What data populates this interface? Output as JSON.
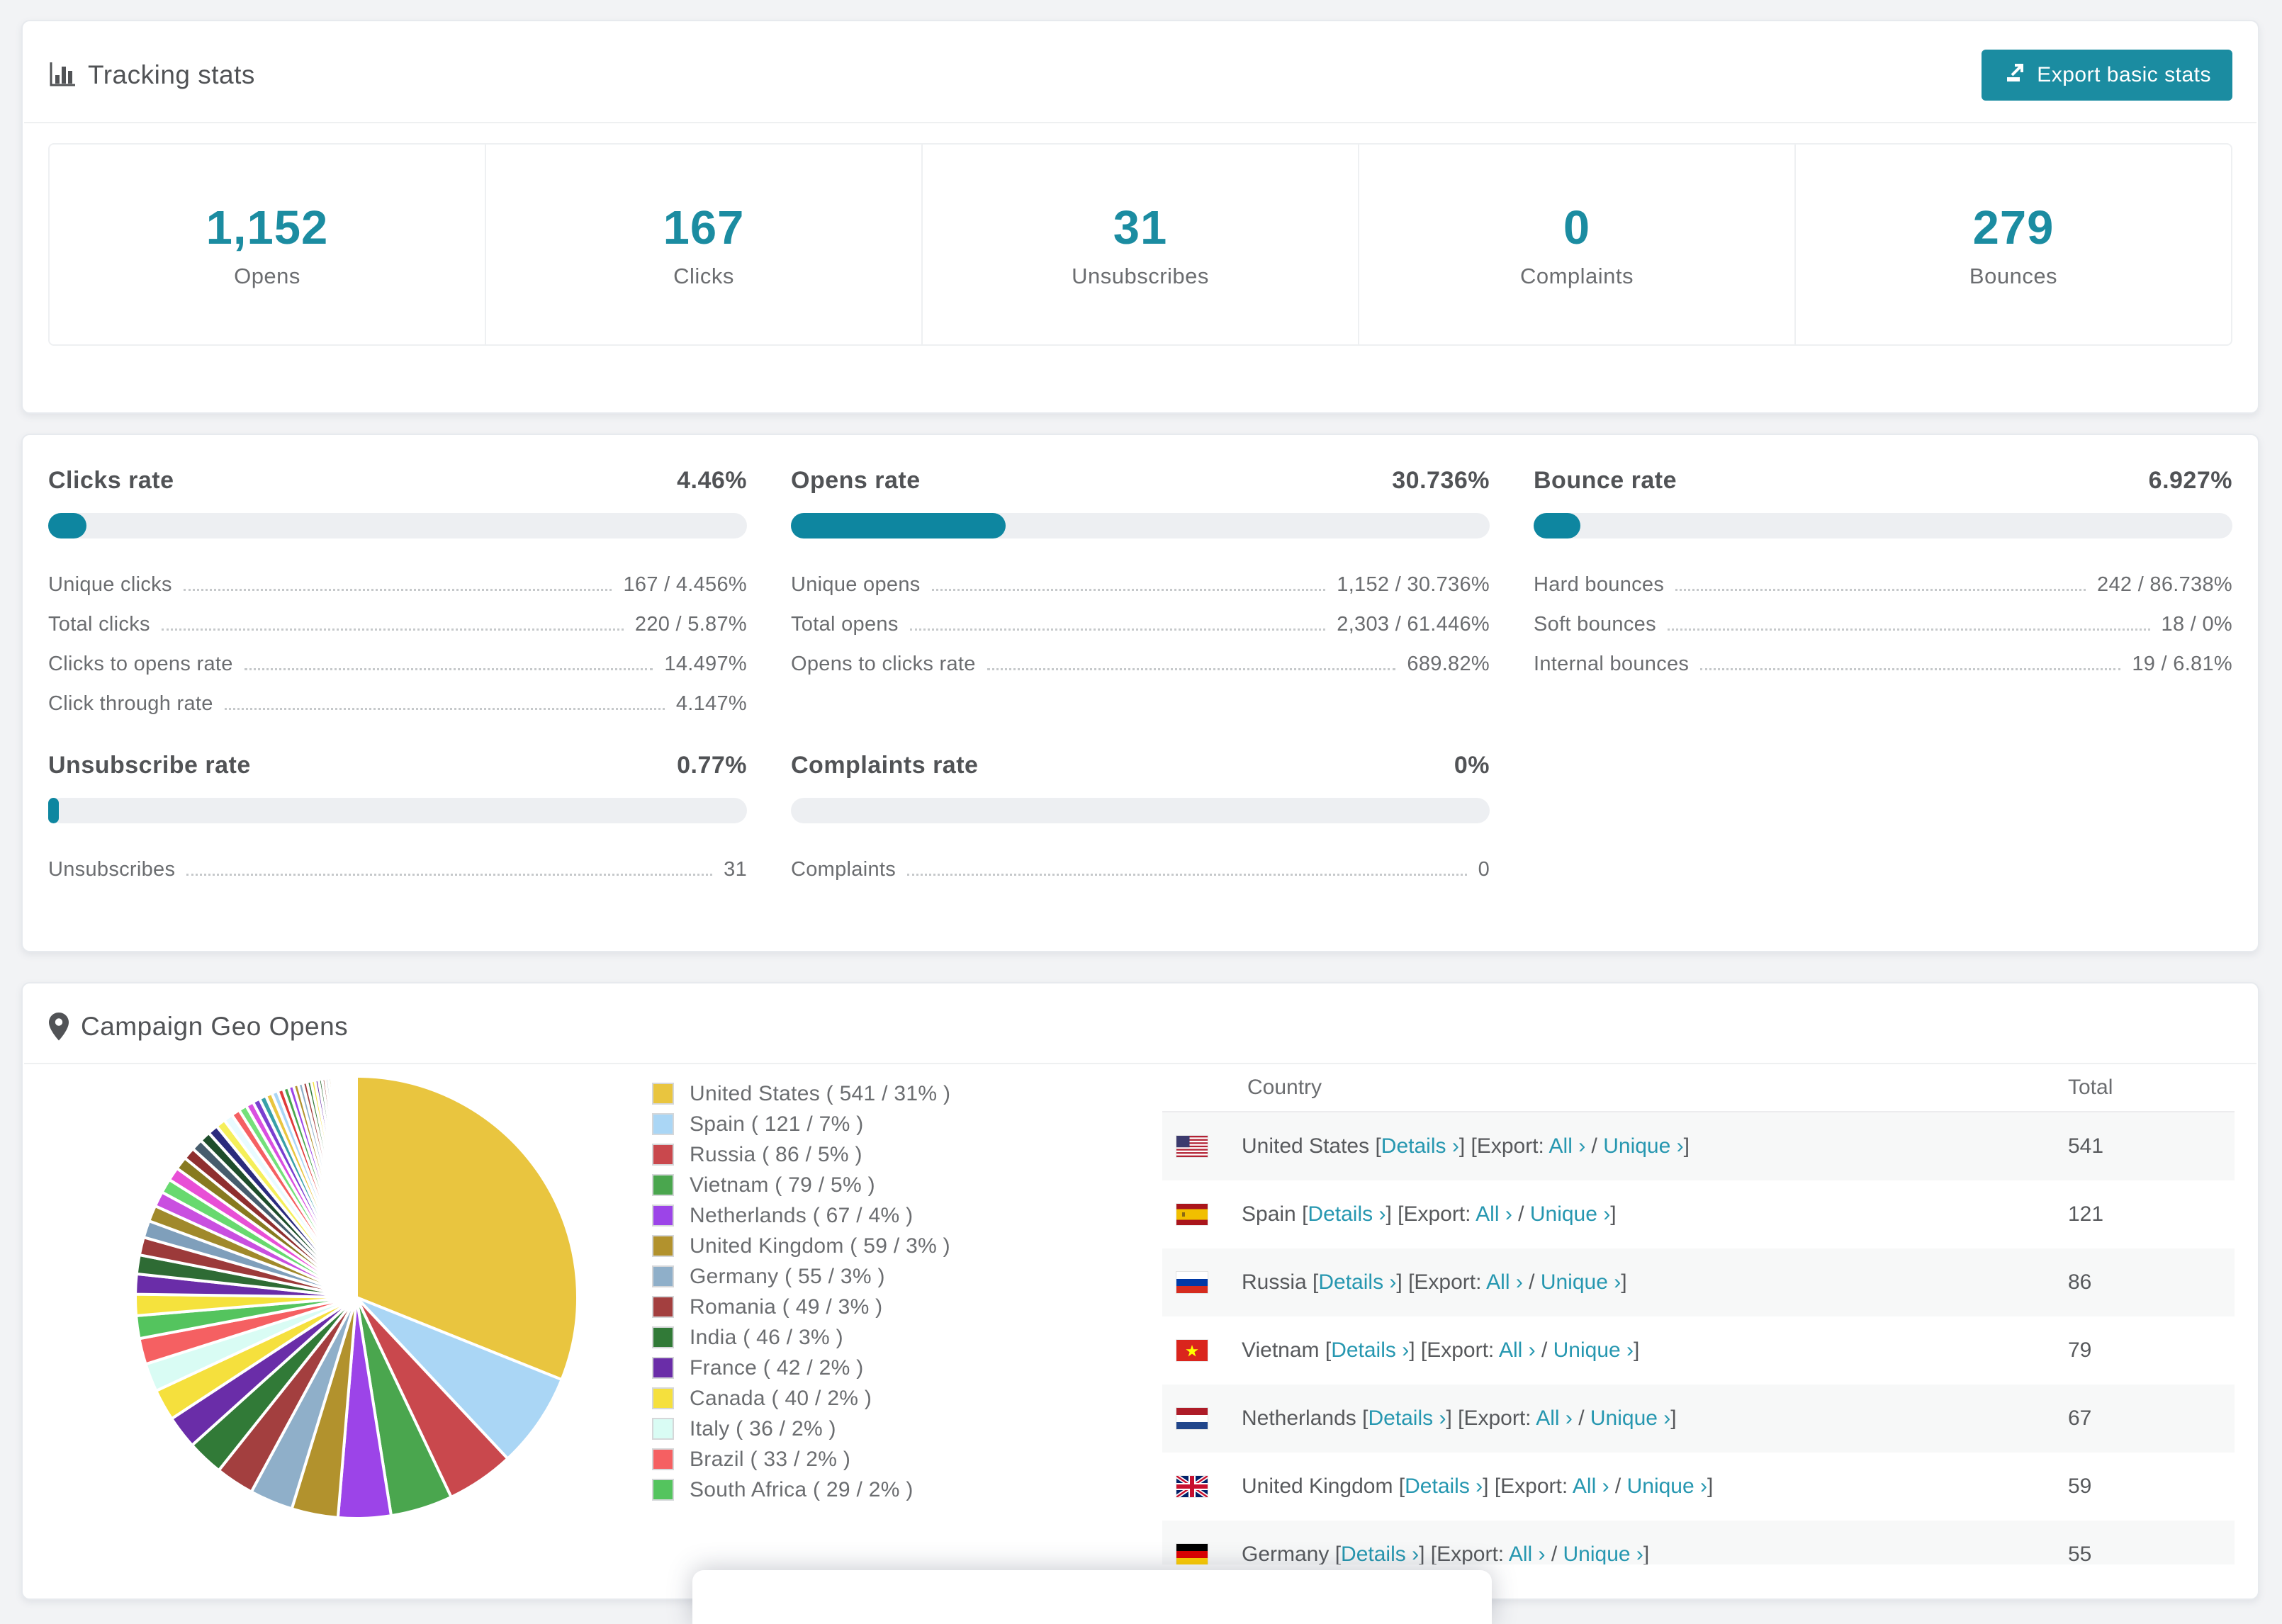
{
  "page": {
    "bg": "#f2f3f5",
    "accent": "#1b8ca1",
    "bar_fill": "#0e86a0",
    "link_color": "#2697b0"
  },
  "tracking": {
    "title": "Tracking stats",
    "export_button": "Export basic stats",
    "summary": [
      {
        "value": "1,152",
        "label": "Opens"
      },
      {
        "value": "167",
        "label": "Clicks"
      },
      {
        "value": "31",
        "label": "Unsubscribes"
      },
      {
        "value": "0",
        "label": "Complaints"
      },
      {
        "value": "279",
        "label": "Bounces"
      }
    ]
  },
  "rates": [
    {
      "title": "Clicks rate",
      "value": "4.46%",
      "fill_pct": 5.5,
      "lines": [
        {
          "label": "Unique clicks",
          "value": "167 / 4.456%"
        },
        {
          "label": "Total clicks",
          "value": "220 / 5.87%"
        },
        {
          "label": "Clicks to opens rate",
          "value": "14.497%"
        },
        {
          "label": "Click through rate",
          "value": "4.147%"
        }
      ]
    },
    {
      "title": "Opens rate",
      "value": "30.736%",
      "fill_pct": 30.7,
      "lines": [
        {
          "label": "Unique opens",
          "value": "1,152 / 30.736%"
        },
        {
          "label": "Total opens",
          "value": "2,303 / 61.446%"
        },
        {
          "label": "Opens to clicks rate",
          "value": "689.82%"
        }
      ]
    },
    {
      "title": "Bounce rate",
      "value": "6.927%",
      "fill_pct": 6.7,
      "lines": [
        {
          "label": "Hard bounces",
          "value": "242 / 86.738%"
        },
        {
          "label": "Soft bounces",
          "value": "18 / 0%"
        },
        {
          "label": "Internal bounces",
          "value": "19 / 6.81%"
        }
      ]
    },
    {
      "title": "Unsubscribe rate",
      "value": "0.77%",
      "fill_pct": 1.5,
      "lines": [
        {
          "label": "Unsubscribes",
          "value": "31"
        }
      ]
    },
    {
      "title": "Complaints rate",
      "value": "0%",
      "fill_pct": 0,
      "lines": [
        {
          "label": "Complaints",
          "value": "0"
        }
      ]
    }
  ],
  "geo": {
    "title": "Campaign Geo Opens",
    "table": {
      "columns": [
        "Country",
        "Total"
      ],
      "links": {
        "details": "Details ›",
        "export_prefix": "Export:",
        "all": "All ›",
        "unique": "Unique ›"
      },
      "rows": [
        {
          "country": "United States",
          "flag": "us",
          "total": "541"
        },
        {
          "country": "Spain",
          "flag": "es",
          "total": "121"
        },
        {
          "country": "Russia",
          "flag": "ru",
          "total": "86"
        },
        {
          "country": "Vietnam",
          "flag": "vn",
          "total": "79"
        },
        {
          "country": "Netherlands",
          "flag": "nl",
          "total": "67"
        },
        {
          "country": "United Kingdom",
          "flag": "gb",
          "total": "59"
        },
        {
          "country": "Germany",
          "flag": "de",
          "total": "55"
        }
      ]
    }
  },
  "chart_data": {
    "type": "pie",
    "title": "Campaign Geo Opens",
    "legend_position": "right",
    "start_angle_deg": -90,
    "direction": "clockwise",
    "slices": [
      {
        "label": "United States",
        "value": 541,
        "pct": 31,
        "color": "#e9c53f"
      },
      {
        "label": "Spain",
        "value": 121,
        "pct": 7,
        "color": "#aad6f5"
      },
      {
        "label": "Russia",
        "value": 86,
        "pct": 5,
        "color": "#c9484d"
      },
      {
        "label": "Vietnam",
        "value": 79,
        "pct": 5,
        "color": "#4aa64e"
      },
      {
        "label": "Netherlands",
        "value": 67,
        "pct": 4,
        "color": "#9c44e8"
      },
      {
        "label": "United Kingdom",
        "value": 59,
        "pct": 3,
        "color": "#b2922d"
      },
      {
        "label": "Germany",
        "value": 55,
        "pct": 3,
        "color": "#8fafc9"
      },
      {
        "label": "Romania",
        "value": 49,
        "pct": 3,
        "color": "#a33f3f"
      },
      {
        "label": "India",
        "value": 46,
        "pct": 3,
        "color": "#317a37"
      },
      {
        "label": "France",
        "value": 42,
        "pct": 2,
        "color": "#6a2da8"
      },
      {
        "label": "Canada",
        "value": 40,
        "pct": 2,
        "color": "#f5e03d"
      },
      {
        "label": "Italy",
        "value": 36,
        "pct": 2,
        "color": "#d9fcf4"
      },
      {
        "label": "Brazil",
        "value": 33,
        "pct": 2,
        "color": "#f56062"
      },
      {
        "label": "South Africa",
        "value": 29,
        "pct": 2,
        "color": "#54c45e"
      }
    ],
    "others": {
      "note": "unlabeled small-country slices filling remainder of pie",
      "total": 452,
      "first": 27,
      "ratio": 0.945,
      "count": 48,
      "palette": [
        "#f5e23d",
        "#6a2da8",
        "#2e6b34",
        "#9c3a3a",
        "#7f9fbb",
        "#a0892b",
        "#c94fe0",
        "#68d96f",
        "#e84fd6",
        "#877a20",
        "#8f2f2f",
        "#475d6d",
        "#1e4d2b",
        "#2b2b7d",
        "#f5ef5a",
        "#e8fbff",
        "#f56062",
        "#74e07a",
        "#d94fe0",
        "#7a3fd0",
        "#39a0a8",
        "#e9c53f",
        "#aad6f5",
        "#e03a3a",
        "#4aa64e",
        "#9c44e8",
        "#b2922d",
        "#8fafc9",
        "#a33f3f",
        "#317a37"
      ]
    }
  }
}
